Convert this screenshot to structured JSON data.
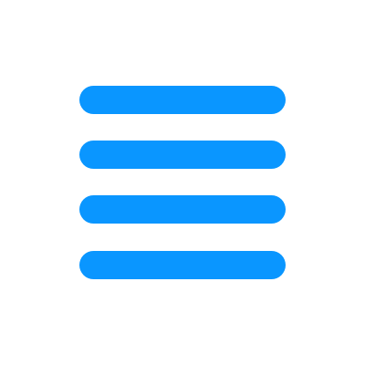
{
  "icon": {
    "name": "hamburger-menu-icon",
    "color": "#0A96FF",
    "bar_count": 4
  },
  "background_color": "#FFFFFF"
}
